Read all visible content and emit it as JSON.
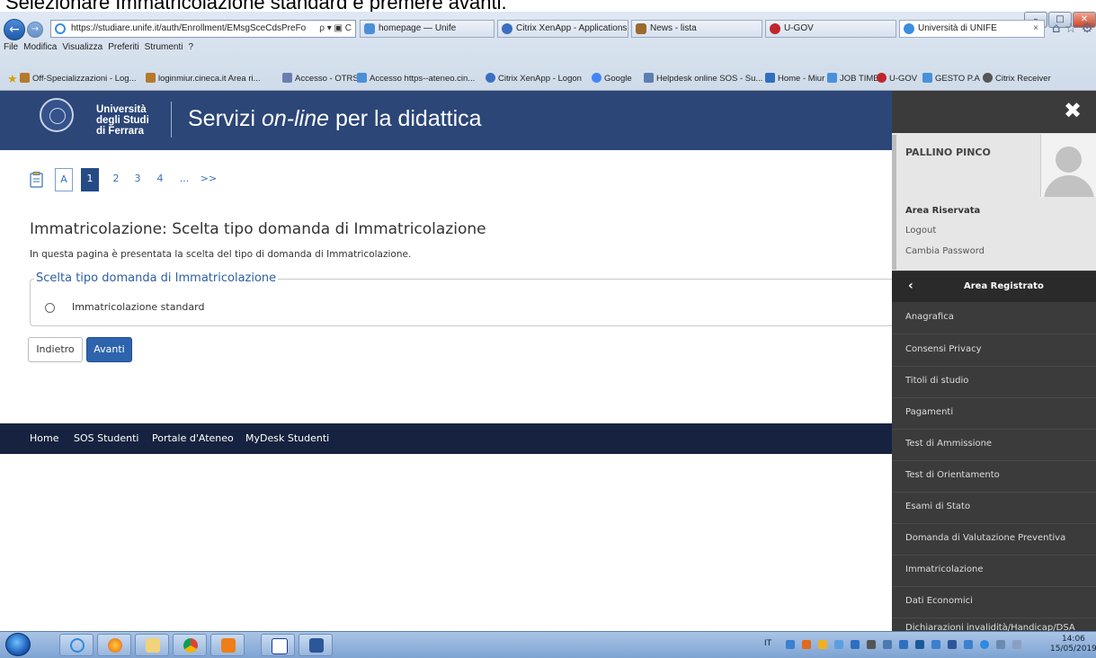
{
  "caption": "Selezionare Immatricolazione standard e premere avanti.",
  "browser": {
    "address_url": "https://studiare.unife.it/auth/Enrollment/EMsgSceCdsPreFo",
    "address_tools": "ρ ▾ ▣ C",
    "tabs": [
      {
        "label": "homepage — Unife",
        "color": "#4a90d9"
      },
      {
        "label": "Citrix XenApp - Applications",
        "color": "#3b6fc2"
      },
      {
        "label": "News - lista",
        "color": "#9b6a2f"
      },
      {
        "label": "U-GOV",
        "color": "#c0262c"
      },
      {
        "label": "Università di UNIFE",
        "color": "#3a8de0"
      }
    ],
    "active_tab_close": "×",
    "menu": [
      "File",
      "Modifica",
      "Visualizza",
      "Preferiti",
      "Strumenti",
      "?"
    ],
    "favorites": [
      {
        "label": "Off-Specializzazioni - Log...",
        "color": "#b57a2a"
      },
      {
        "label": "loginmiur.cineca.it  Area ri...",
        "color": "#b57a2a"
      },
      {
        "label": "Accesso - OTRS",
        "color": "#6a7fb0"
      },
      {
        "label": "Accesso https--ateneo.cin...",
        "color": "#4a90d9"
      },
      {
        "label": "Citrix XenApp - Logon",
        "color": "#3b6fc2"
      },
      {
        "label": "Google",
        "color": "#4285f4"
      },
      {
        "label": "Helpdesk online SOS - Su...",
        "color": "#5b7fb0"
      },
      {
        "label": "Home - Miur",
        "color": "#2f6fc0"
      },
      {
        "label": "JOB TIME",
        "color": "#4a90d9"
      },
      {
        "label": "U-GOV",
        "color": "#c0262c"
      },
      {
        "label": "GESTO P.A",
        "color": "#4a90d9"
      },
      {
        "label": "Citrix Receiver",
        "color": "#555555"
      }
    ]
  },
  "header": {
    "uni_line1": "Università",
    "uni_line2": "degli Studi",
    "uni_line3": "di Ferrara",
    "title_pre": "Servizi ",
    "title_em": "on-line",
    "title_post": " per la didattica",
    "bg_color": "#2b4677"
  },
  "steps": [
    "A",
    "1",
    "2",
    "3",
    "4",
    "...",
    ">>"
  ],
  "page": {
    "title": "Immatricolazione: Scelta tipo domanda di Immatricolazione",
    "description": "In questa pagina è presentata la scelta del tipo di domanda di Immatricolazione.",
    "fieldset_legend": "Scelta tipo domanda di Immatricolazione",
    "radio_option": "Immatricolazione standard",
    "back_label": "Indietro",
    "next_label": "Avanti"
  },
  "footer": [
    "Home",
    "SOS Studenti",
    "Portale d'Ateneo",
    "MyDesk Studenti"
  ],
  "side": {
    "close_icon": "✖",
    "user_name": "PALLINO PINCO",
    "area_riservata": "Area Riservata",
    "logout": "Logout",
    "cambia_password": "Cambia Password",
    "back_chevron": "‹",
    "area_registrato": "Area Registrato",
    "items": [
      "Anagrafica",
      "Consensi Privacy",
      "Titoli di studio",
      "Pagamenti",
      "Test di Ammissione",
      "Test di Orientamento",
      "Esami di Stato",
      "Domanda di Valutazione Preventiva",
      "Immatricolazione",
      "Dati Economici",
      "Dichiarazioni invalidità/Handicap/DSA"
    ]
  },
  "taskbar": {
    "apps": [
      "ie",
      "firefox",
      "explorer",
      "chrome",
      "media",
      "library",
      "word"
    ],
    "lang": "IT",
    "time": "14:06",
    "date": "15/05/2019"
  }
}
